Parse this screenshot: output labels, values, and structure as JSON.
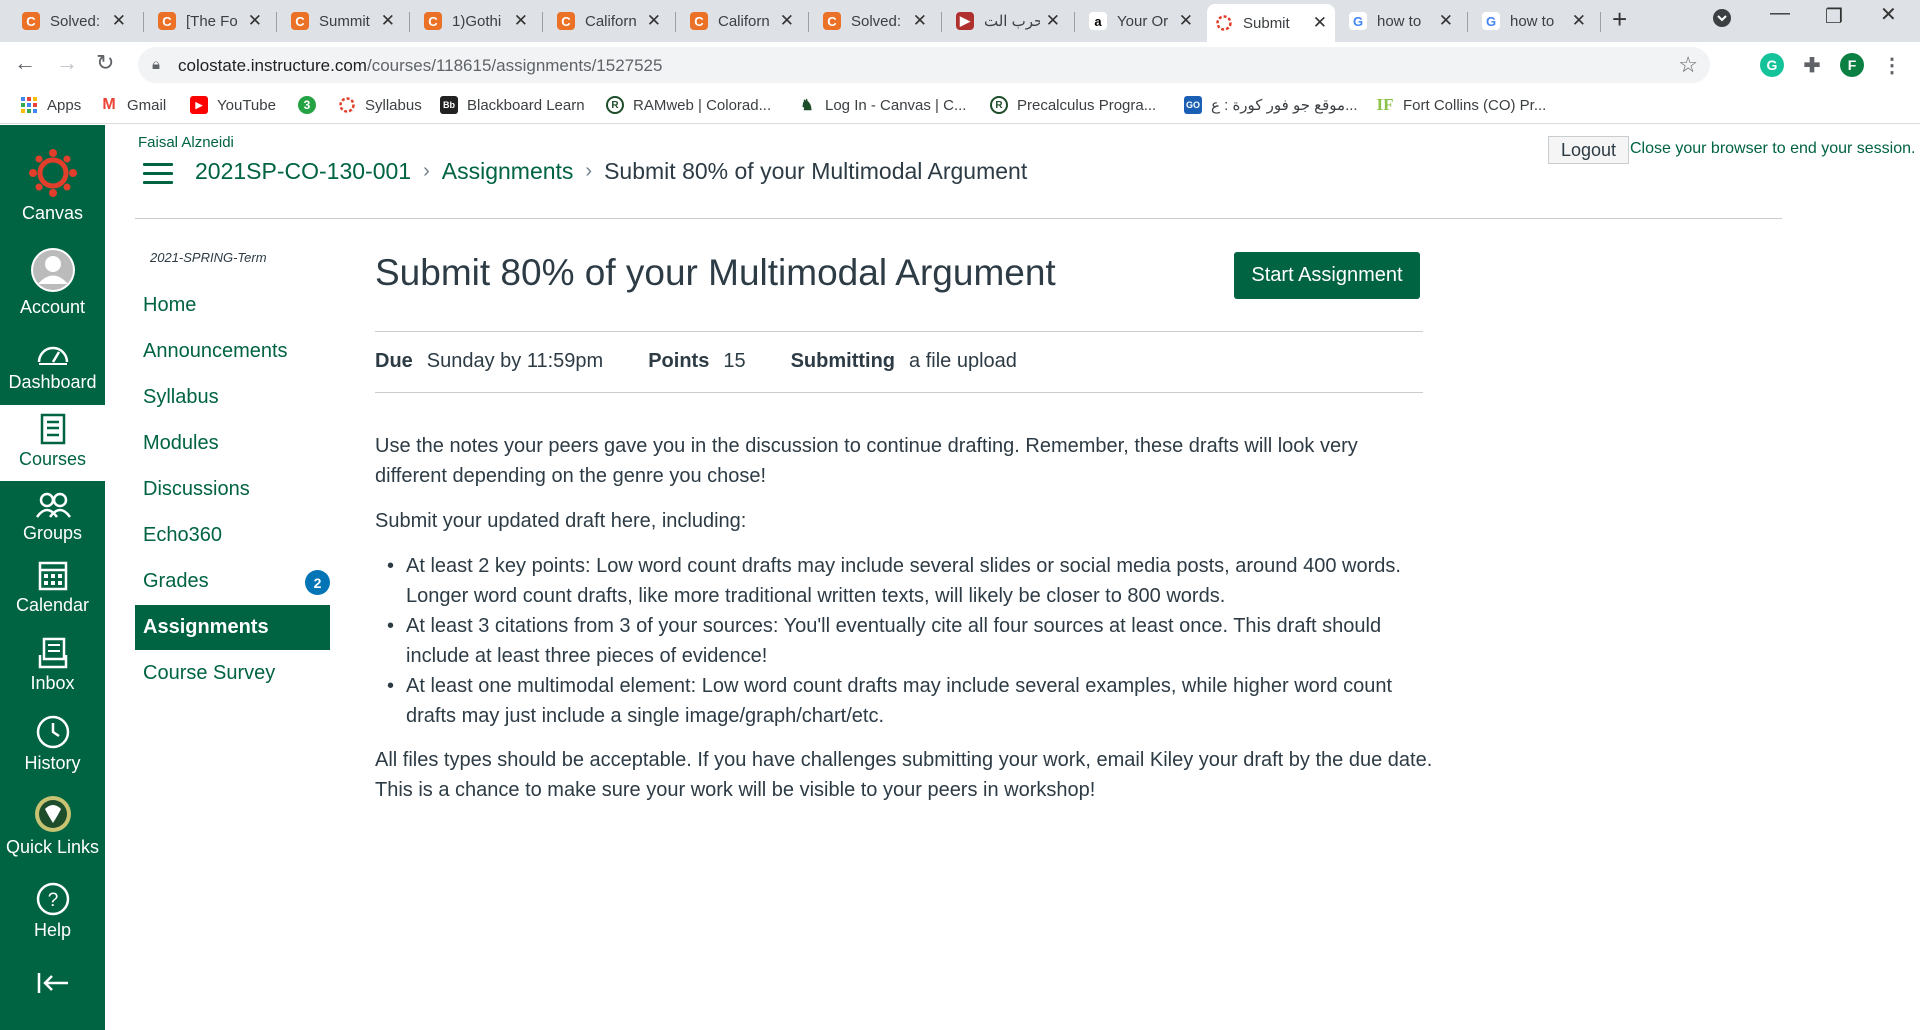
{
  "browser": {
    "tabs": [
      {
        "title": "Solved:",
        "icon": "chegg-icon",
        "color": "#ea7125"
      },
      {
        "title": "[The Fo",
        "icon": "chegg-icon",
        "color": "#ea7125"
      },
      {
        "title": "Summit",
        "icon": "chegg-icon",
        "color": "#ea7125"
      },
      {
        "title": "1)Gothi",
        "icon": "chegg-icon",
        "color": "#ea7125"
      },
      {
        "title": "Californ",
        "icon": "chegg-icon",
        "color": "#ea7125"
      },
      {
        "title": "Californ",
        "icon": "chegg-icon",
        "color": "#ea7125"
      },
      {
        "title": "Solved:",
        "icon": "chegg-icon",
        "color": "#ea7125"
      },
      {
        "title": "حرب الت",
        "icon": "video-thumbnail-icon",
        "color": "#b03030"
      },
      {
        "title": "Your Or",
        "icon": "amazon-icon",
        "color": "#000000"
      },
      {
        "title": "Submit",
        "icon": "canvas-icon",
        "color": "#e13f2b",
        "active": true
      },
      {
        "title": "how to",
        "icon": "google-icon",
        "color": "#4285f4"
      },
      {
        "title": "how to",
        "icon": "google-icon",
        "color": "#4285f4"
      }
    ],
    "new_tab": "+",
    "url_host": "colostate.instructure.com",
    "url_path": "/courses/118615/assignments/1527525",
    "profile_initial": "F",
    "bookmarks": [
      {
        "label": "Apps",
        "icon": "apps-grid-icon"
      },
      {
        "label": "Gmail",
        "icon": "gmail-icon"
      },
      {
        "label": "YouTube",
        "icon": "youtube-icon"
      },
      {
        "label": "",
        "icon": "green-3-icon"
      },
      {
        "label": "Syllabus",
        "icon": "canvas-icon"
      },
      {
        "label": "Blackboard Learn",
        "icon": "blackboard-icon"
      },
      {
        "label": "RAMweb | Colorad...",
        "icon": "csu-ram-icon"
      },
      {
        "label": "Log In - Canvas | C...",
        "icon": "csu-ram-icon"
      },
      {
        "label": "Precalculus Progra...",
        "icon": "csu-ram-icon"
      },
      {
        "label": "موقع جو فور كورة : ع...",
        "icon": "goal-icon"
      },
      {
        "label": "Fort Collins (CO) Pr...",
        "icon": "if-icon"
      }
    ]
  },
  "global_nav": {
    "logo_label": "Canvas",
    "items": [
      {
        "label": "Account"
      },
      {
        "label": "Dashboard"
      },
      {
        "label": "Courses"
      },
      {
        "label": "Groups"
      },
      {
        "label": "Calendar"
      },
      {
        "label": "Inbox"
      },
      {
        "label": "History"
      },
      {
        "label": "Quick Links"
      },
      {
        "label": "Help"
      }
    ]
  },
  "header": {
    "user_name": "Faisal Alzneidi",
    "logout_label": "Logout",
    "logout_message": "Close your browser to end your session.",
    "breadcrumbs": [
      "2021SP-CO-130-001",
      "Assignments",
      "Submit 80% of your Multimodal Argument"
    ]
  },
  "course_nav": {
    "term": "2021-SPRING-Term",
    "items": [
      {
        "label": "Home"
      },
      {
        "label": "Announcements"
      },
      {
        "label": "Syllabus"
      },
      {
        "label": "Modules"
      },
      {
        "label": "Discussions"
      },
      {
        "label": "Echo360"
      },
      {
        "label": "Grades",
        "badge": "2"
      },
      {
        "label": "Assignments",
        "active": true
      },
      {
        "label": "Course Survey"
      }
    ]
  },
  "assignment": {
    "title": "Submit 80% of your Multimodal Argument",
    "start_label": "Start Assignment",
    "due_label": "Due",
    "due_value": "Sunday by 11:59pm",
    "points_label": "Points",
    "points_value": "15",
    "submitting_label": "Submitting",
    "submitting_value": "a file upload",
    "para1_line1": "Use the notes your peers gave you in the discussion to continue drafting. Remember, these drafts will look very",
    "para1_line2": "different depending on the genre you chose!",
    "para2": "Submit your updated draft here, including:",
    "bullets": [
      [
        "At least 2 key points: Low word count drafts may include several slides or social media posts, around 400 words.",
        "Longer word count drafts, like more traditional written texts, will likely be closer to 800 words."
      ],
      [
        "At least 3 citations from 3 of your sources: You'll eventually cite all four sources at least once. This draft should",
        "include at least three pieces of evidence!"
      ],
      [
        "At least one multimodal element: Low word count drafts may include several examples, while higher word count",
        "drafts may just include a single image/graph/chart/etc."
      ]
    ],
    "para3_line1": "All files types should be acceptable. If you have challenges submitting your work, email Kiley your draft by the due date.",
    "para3_line2": "This is a chance to make sure your work will be visible to your peers in workshop!"
  },
  "colors": {
    "brand": "#006341",
    "badge": "#0374b5",
    "text": "#2d3b45"
  }
}
